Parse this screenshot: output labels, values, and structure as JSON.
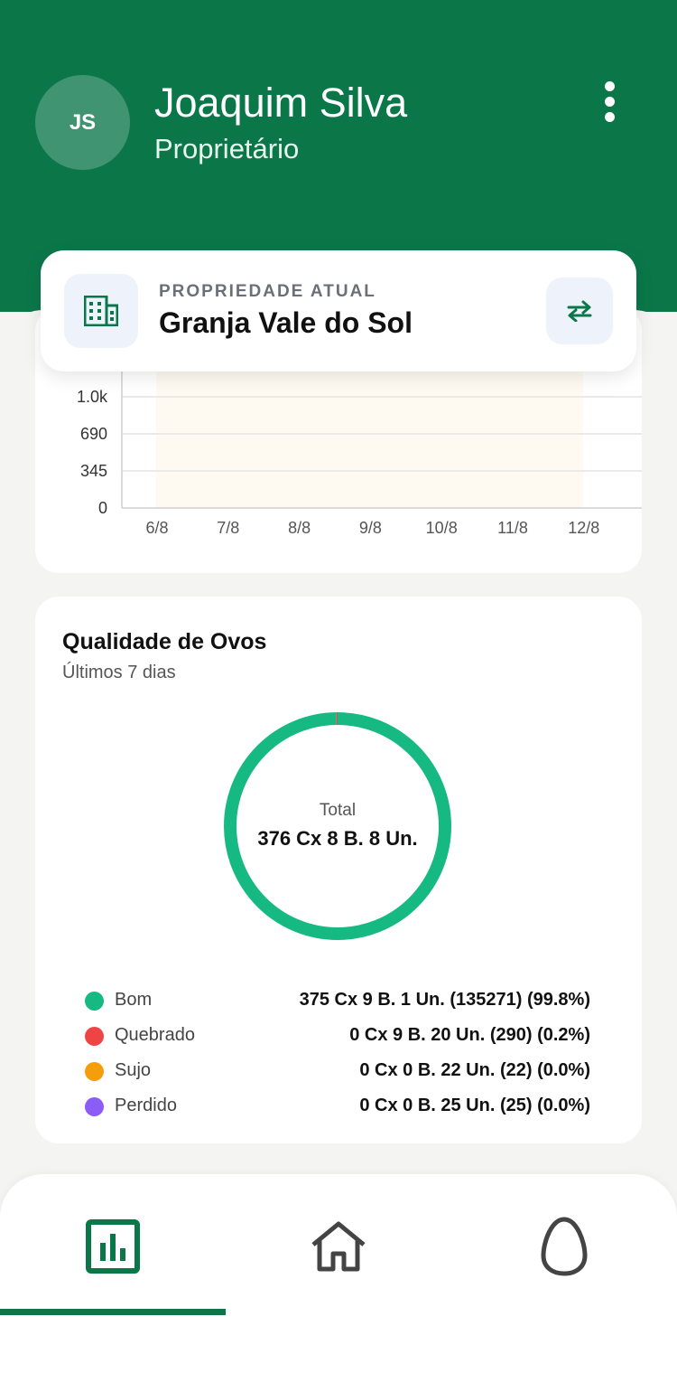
{
  "header": {
    "avatar_initials": "JS",
    "user_name": "Joaquim Silva",
    "user_role": "Proprietário",
    "menu_icon": "more-vertical-icon"
  },
  "property": {
    "label": "PROPRIEDADE ATUAL",
    "name": "Granja Vale do Sol",
    "property_icon": "building-icon",
    "switch_icon": "swap-arrows-icon"
  },
  "chart_data": {
    "type": "bar",
    "categories": [
      "6/8",
      "7/8",
      "8/8",
      "9/8",
      "10/8",
      "11/8",
      "12/8"
    ],
    "yticks": [
      "0",
      "345",
      "690",
      "1.0k"
    ],
    "ylim": [
      0,
      1380
    ],
    "grid": true,
    "title": "",
    "xlabel": "",
    "ylabel": ""
  },
  "quality": {
    "title": "Qualidade de Ovos",
    "subtitle": "Últimos 7 dias",
    "total_label": "Total",
    "total_value": "376 Cx 8 B. 8 Un.",
    "legend": [
      {
        "name": "Bom",
        "value": "375 Cx 9 B. 1 Un. (135271) (99.8%)",
        "color": "#16b981",
        "percent": 99.8
      },
      {
        "name": "Quebrado",
        "value": "0 Cx 9 B. 20 Un. (290) (0.2%)",
        "color": "#ef4444",
        "percent": 0.2
      },
      {
        "name": "Sujo",
        "value": "0 Cx 0 B. 22 Un. (22) (0.0%)",
        "color": "#f59e0b",
        "percent": 0.0
      },
      {
        "name": "Perdido",
        "value": "0 Cx 0 B. 25 Un. (25) (0.0%)",
        "color": "#8b5cf6",
        "percent": 0.0
      }
    ]
  },
  "nav": {
    "items": [
      {
        "icon": "bar-chart-icon",
        "active": true
      },
      {
        "icon": "home-icon",
        "active": false
      },
      {
        "icon": "egg-icon",
        "active": false
      }
    ],
    "active_color": "#0b7749"
  },
  "colors": {
    "brand": "#0b7749"
  }
}
